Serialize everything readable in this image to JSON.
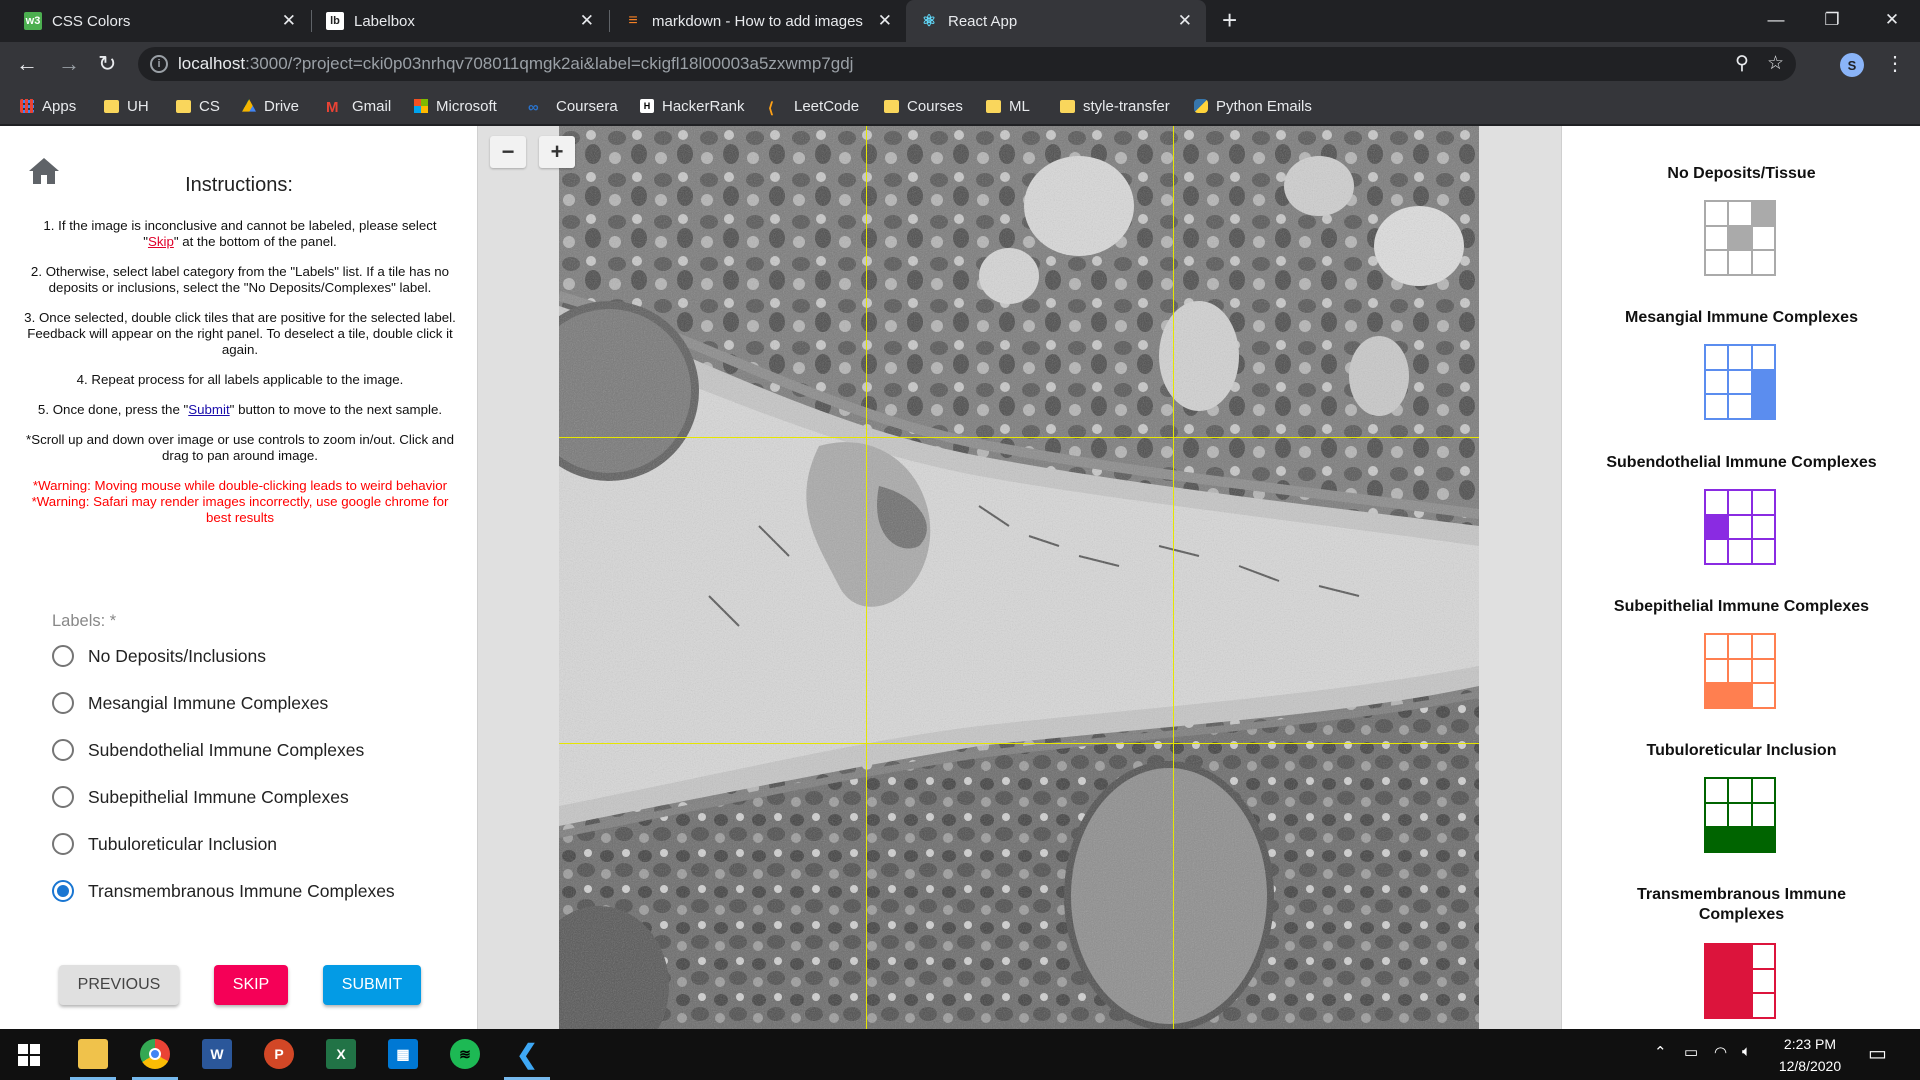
{
  "browser": {
    "tabs": [
      {
        "title": "CSS Colors",
        "favicon": "w3",
        "favicon_color": "#4caf50"
      },
      {
        "title": "Labelbox",
        "favicon": "lb",
        "favicon_color": "#ffffff"
      },
      {
        "title": "markdown - How to add images",
        "favicon": "so",
        "favicon_color": "#f48024"
      },
      {
        "title": "React App",
        "favicon": "react",
        "favicon_color": "#61dafb"
      }
    ],
    "url_host": "localhost",
    "url_rest": ":3000/?project=cki0p03nrhqv708011qmgk2ai&label=ckigfl18l00003a5zxwmp7gdj",
    "profile_initial": "S",
    "bookmarks": [
      {
        "label": "Apps",
        "icon": "apps-grid-icon"
      },
      {
        "label": "UH",
        "icon": "folder-icon"
      },
      {
        "label": "CS",
        "icon": "folder-icon"
      },
      {
        "label": "Drive",
        "icon": "drive-icon"
      },
      {
        "label": "Gmail",
        "icon": "gmail-icon"
      },
      {
        "label": "Microsoft",
        "icon": "microsoft-icon"
      },
      {
        "label": "Coursera",
        "icon": "coursera-icon"
      },
      {
        "label": "HackerRank",
        "icon": "hackerrank-icon"
      },
      {
        "label": "LeetCode",
        "icon": "leetcode-icon"
      },
      {
        "label": "Courses",
        "icon": "folder-icon"
      },
      {
        "label": "ML",
        "icon": "folder-icon"
      },
      {
        "label": "style-transfer",
        "icon": "folder-icon"
      },
      {
        "label": "Python Emails",
        "icon": "python-icon"
      }
    ]
  },
  "instructions": {
    "title": "Instructions:",
    "step1_pre": "1. If the image is inconclusive and cannot be labeled, please select \"",
    "step1_link": "Skip",
    "step1_post": "\" at the bottom of the panel.",
    "step2": "2. Otherwise, select label category from the \"Labels\" list. If a tile has no deposits or inclusions, select the \"No Deposits/Complexes\" label.",
    "step3": "3. Once selected, double click tiles that are positive for the selected label. Feedback will appear on the right panel. To deselect a tile, double click it again.",
    "step4": "4. Repeat process for all labels applicable to the image.",
    "step5_pre": "5. Once done, press the \"",
    "step5_link": "Submit",
    "step5_post": "\" button to move to the next sample.",
    "zoom_note": "*Scroll up and down over image or use controls to zoom in/out. Click and drag to pan around image.",
    "warning1": "*Warning: Moving mouse while double-clicking leads to weird behavior",
    "warning2": "*Warning: Safari may render images incorrectly, use google chrome for best results"
  },
  "labels": {
    "header": "Labels: *",
    "options": [
      {
        "label": "No Deposits/Inclusions",
        "selected": false
      },
      {
        "label": "Mesangial Immune Complexes",
        "selected": false
      },
      {
        "label": "Subendothelial Immune Complexes",
        "selected": false
      },
      {
        "label": "Subepithelial Immune Complexes",
        "selected": false
      },
      {
        "label": "Tubuloreticular Inclusion",
        "selected": false
      },
      {
        "label": "Transmembranous Immune Complexes",
        "selected": true
      }
    ]
  },
  "buttons": {
    "previous": "PREVIOUS",
    "skip": "SKIP",
    "submit": "SUBMIT"
  },
  "viewer": {
    "zoom_out": "−",
    "zoom_in": "+"
  },
  "legend": [
    {
      "title": "No Deposits/Tissue",
      "color": "#aaaaaa",
      "filled": [
        2,
        4
      ]
    },
    {
      "title": "Mesangial Immune Complexes",
      "color": "#5b8def",
      "filled": [
        5,
        8
      ]
    },
    {
      "title": "Subendothelial Immune Complexes",
      "color": "#8a2be2",
      "filled": [
        3
      ]
    },
    {
      "title": "Subepithelial Immune Complexes",
      "color": "#ff7f50",
      "filled": [
        6,
        7
      ]
    },
    {
      "title": "Tubuloreticular Inclusion",
      "color": "#006400",
      "filled": [
        6,
        7,
        8
      ]
    },
    {
      "title": "Transmembranous Immune Complexes",
      "color": "#dc143c",
      "filled": [
        0,
        1,
        3,
        4,
        6,
        7
      ]
    }
  ],
  "taskbar": {
    "time": "2:23 PM",
    "date": "12/8/2020"
  }
}
